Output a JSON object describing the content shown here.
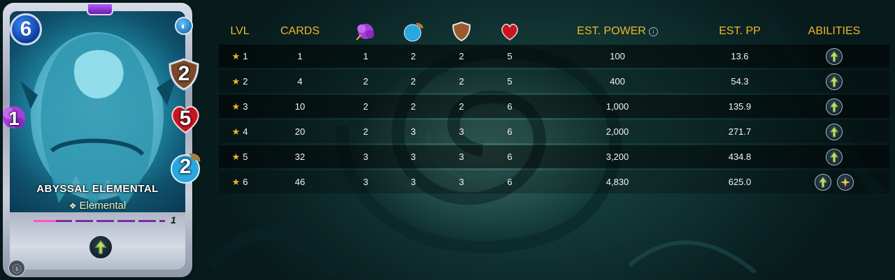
{
  "card": {
    "mana": "6",
    "armor": "2",
    "health": "5",
    "speed": "2",
    "magic": "1",
    "name": "ABYSSAL ELEMENTAL",
    "type": "Elemental",
    "level": "1",
    "xp_progress": 0.17,
    "ability_icon": "void-ability-icon",
    "edition_icon": "edition-icon"
  },
  "table": {
    "headers": {
      "lvl": "LVL",
      "cards": "CARDS",
      "magic_icon": "magic-attack-icon",
      "speed_icon": "speed-icon",
      "armor_icon": "armor-shield-icon",
      "health_icon": "health-heart-icon",
      "est_power": "EST. POWER",
      "est_pp": "EST. PP",
      "abilities": "ABILITIES"
    },
    "rows": [
      {
        "lvl": "1",
        "cards": "1",
        "magic": "1",
        "speed": "2",
        "armor": "2",
        "health": "5",
        "power": "100",
        "pp": "13.6",
        "abilities": [
          "void"
        ]
      },
      {
        "lvl": "2",
        "cards": "4",
        "magic": "2",
        "speed": "2",
        "armor": "2",
        "health": "5",
        "power": "400",
        "pp": "54.3",
        "abilities": [
          "void"
        ]
      },
      {
        "lvl": "3",
        "cards": "10",
        "magic": "2",
        "speed": "2",
        "armor": "2",
        "health": "6",
        "power": "1,000",
        "pp": "135.9",
        "abilities": [
          "void"
        ]
      },
      {
        "lvl": "4",
        "cards": "20",
        "magic": "2",
        "speed": "3",
        "armor": "3",
        "health": "6",
        "power": "2,000",
        "pp": "271.7",
        "abilities": [
          "void"
        ]
      },
      {
        "lvl": "5",
        "cards": "32",
        "magic": "3",
        "speed": "3",
        "armor": "3",
        "health": "6",
        "power": "3,200",
        "pp": "434.8",
        "abilities": [
          "void"
        ]
      },
      {
        "lvl": "6",
        "cards": "46",
        "magic": "3",
        "speed": "3",
        "armor": "3",
        "health": "6",
        "power": "4,830",
        "pp": "625.0",
        "abilities": [
          "void",
          "spark"
        ]
      }
    ]
  },
  "colors": {
    "header_gold": "#f2b52b",
    "background_teal": "#123634"
  }
}
